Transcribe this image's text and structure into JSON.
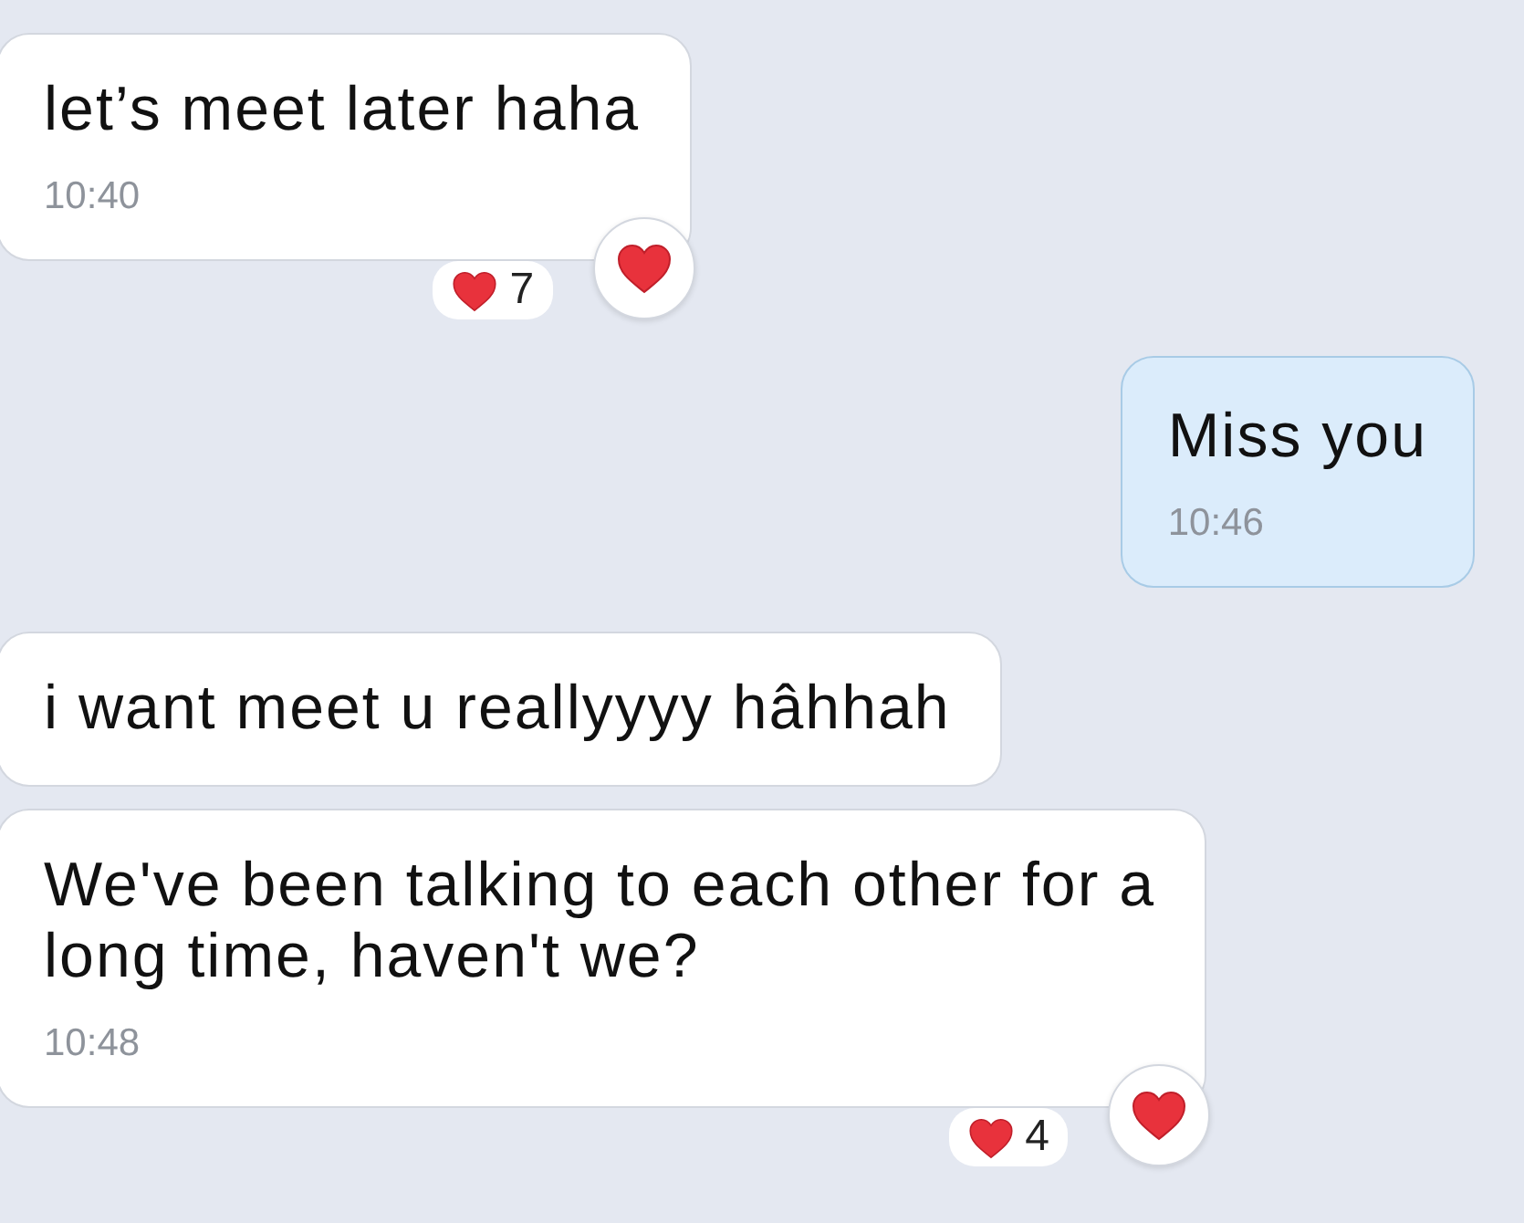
{
  "messages": [
    {
      "kind": "received",
      "lines": [
        "let’s meet later haha"
      ],
      "time": "10:40",
      "reaction_count": "7"
    },
    {
      "kind": "sent",
      "lines": [
        "Miss you"
      ],
      "time": "10:46"
    },
    {
      "kind": "received",
      "lines": [
        "i want meet u reallyyyy hâhhah"
      ]
    },
    {
      "kind": "received",
      "lines": [
        "We've been talking to each other for a",
        "long time, haven't we?"
      ],
      "time": "10:48",
      "reaction_count": "4"
    }
  ]
}
